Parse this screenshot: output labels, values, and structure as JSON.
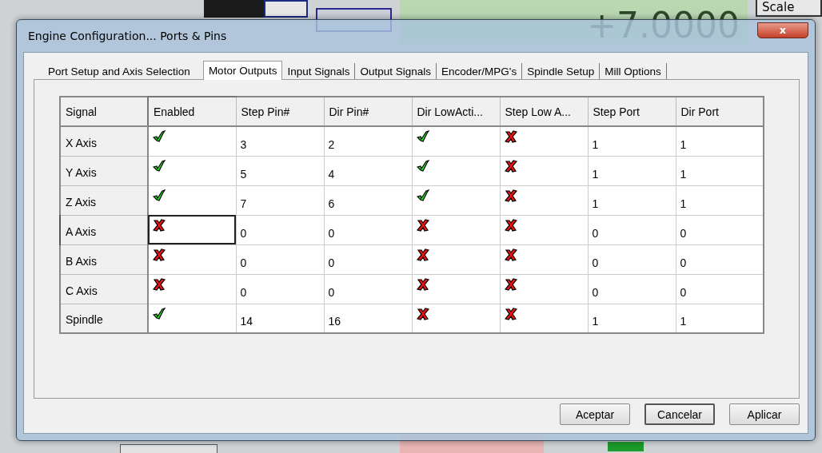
{
  "background": {
    "dro_value": "+7.0000",
    "scale_label": "Scale"
  },
  "window": {
    "title": "Engine Configuration... Ports & Pins",
    "close": "x"
  },
  "tabs": [
    {
      "label": "Port Setup and Axis Selection",
      "selected": false
    },
    {
      "label": "Motor Outputs",
      "selected": true
    },
    {
      "label": "Input Signals",
      "selected": false
    },
    {
      "label": "Output Signals",
      "selected": false
    },
    {
      "label": "Encoder/MPG's",
      "selected": false
    },
    {
      "label": "Spindle Setup",
      "selected": false
    },
    {
      "label": "Mill Options",
      "selected": false
    }
  ],
  "table": {
    "columns": [
      {
        "label": "Signal",
        "kind": "header",
        "focused": false
      },
      {
        "label": "Enabled",
        "kind": "flag",
        "focused": true
      },
      {
        "label": "Step Pin#",
        "kind": "text",
        "focused": false
      },
      {
        "label": "Dir Pin#",
        "kind": "text",
        "focused": false
      },
      {
        "label": "Dir LowActi...",
        "kind": "flag",
        "focused": false
      },
      {
        "label": "Step Low A...",
        "kind": "flag",
        "focused": false
      },
      {
        "label": "Step Port",
        "kind": "text",
        "focused": false
      },
      {
        "label": "Dir Port",
        "kind": "text",
        "focused": false
      }
    ],
    "rows": [
      {
        "cells": [
          "X Axis",
          true,
          "3",
          "2",
          true,
          false,
          "1",
          "1"
        ],
        "focused": false
      },
      {
        "cells": [
          "Y Axis",
          true,
          "5",
          "4",
          true,
          false,
          "1",
          "1"
        ],
        "focused": false
      },
      {
        "cells": [
          "Z Axis",
          true,
          "7",
          "6",
          true,
          false,
          "1",
          "1"
        ],
        "focused": false
      },
      {
        "cells": [
          "A Axis",
          false,
          "0",
          "0",
          false,
          false,
          "0",
          "0"
        ],
        "focused": true
      },
      {
        "cells": [
          "B Axis",
          false,
          "0",
          "0",
          false,
          false,
          "0",
          "0"
        ],
        "focused": false
      },
      {
        "cells": [
          "C Axis",
          false,
          "0",
          "0",
          false,
          false,
          "0",
          "0"
        ],
        "focused": false
      },
      {
        "cells": [
          "Spindle",
          true,
          "14",
          "16",
          false,
          false,
          "1",
          "1"
        ],
        "focused": false
      }
    ]
  },
  "buttons": [
    {
      "label": "Aceptar",
      "default": false
    },
    {
      "label": "Cancelar",
      "default": true
    },
    {
      "label": "Aplicar",
      "default": false
    }
  ]
}
